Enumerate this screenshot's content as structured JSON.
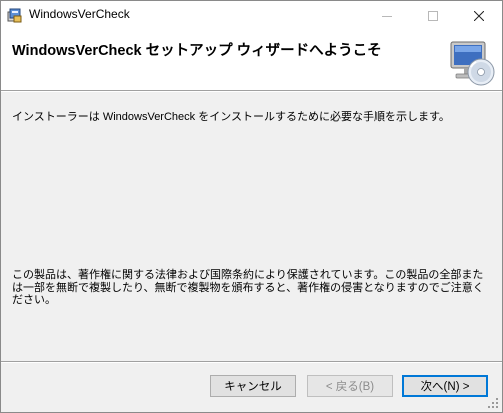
{
  "window": {
    "title": "WindowsVerCheck",
    "minimize_icon": "minimize-icon",
    "maximize_icon": "maximize-icon",
    "close_icon": "close-icon"
  },
  "banner": {
    "title": "WindowsVerCheck セットアップ ウィザードへようこそ",
    "graphic_icon": "computer-cd-icon"
  },
  "body": {
    "intro": "インストーラーは WindowsVerCheck をインストールするために必要な手順を示します。",
    "copyright_notice": "この製品は、著作権に関する法律および国際条約により保護されています。この製品の全部または一部を無断で複製したり、無断で複製物を頒布すると、著作権の侵害となりますのでご注意ください。"
  },
  "buttons": {
    "cancel": "キャンセル",
    "back": "< 戻る(B)",
    "next": "次へ(N) >"
  },
  "colors": {
    "window_bg": "#f0f0f0",
    "banner_bg": "#ffffff",
    "default_button_border": "#0078d7"
  }
}
